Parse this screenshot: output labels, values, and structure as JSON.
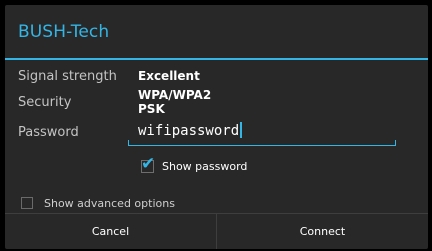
{
  "dialog": {
    "title": "BUSH-Tech",
    "accent_color": "#33b5e5"
  },
  "details": {
    "signal_label": "Signal strength",
    "signal_value": "Excellent",
    "security_label": "Security",
    "security_value": "WPA/WPA2 PSK",
    "password_label": "Password"
  },
  "password_field": {
    "value": "wifipassword"
  },
  "show_password": {
    "label": "Show password",
    "checked": true
  },
  "advanced_options": {
    "label": "Show advanced options",
    "checked": false
  },
  "buttons": {
    "cancel": "Cancel",
    "connect": "Connect"
  }
}
